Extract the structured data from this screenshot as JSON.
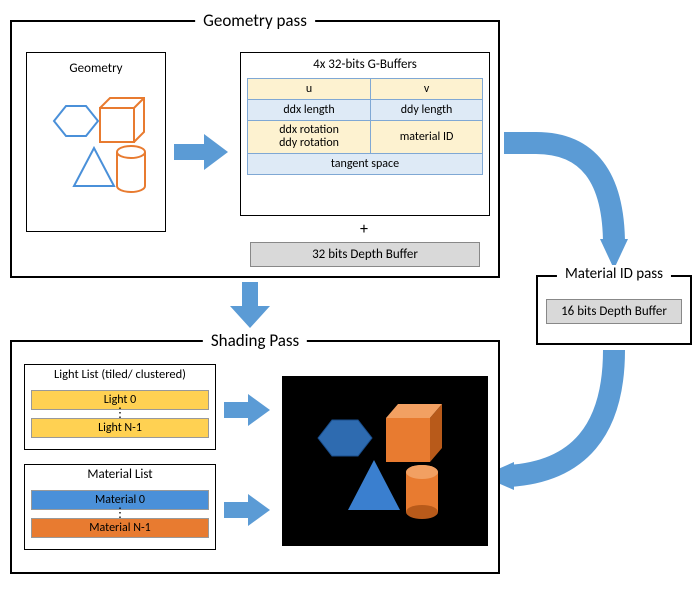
{
  "geometry_pass": {
    "title": "Geometry pass",
    "geometry_label": "Geometry",
    "gbuffers": {
      "title": "4x 32-bits G-Buffers",
      "r1c1": "u",
      "r1c2": "v",
      "r2c1": "ddx length",
      "r2c2": "ddy length",
      "r3c1": "ddx rotation\nddy rotation",
      "r3c2": "material ID",
      "r4": "tangent space"
    },
    "plus": "+",
    "depth_buffer": "32 bits Depth Buffer"
  },
  "material_id_pass": {
    "title": "Material ID pass",
    "depth_buffer": "16 bits Depth Buffer"
  },
  "shading_pass": {
    "title": "Shading Pass",
    "light_list": {
      "title": "Light List (tiled/ clustered)",
      "item0": "Light 0",
      "itemN": "Light N-1"
    },
    "material_list": {
      "title": "Material List",
      "item0": "Material 0",
      "itemN": "Material N-1"
    }
  },
  "colors": {
    "arrow": "#5b9bd5",
    "shape_blue": "#4a90d9",
    "shape_orange": "#e87b30"
  }
}
